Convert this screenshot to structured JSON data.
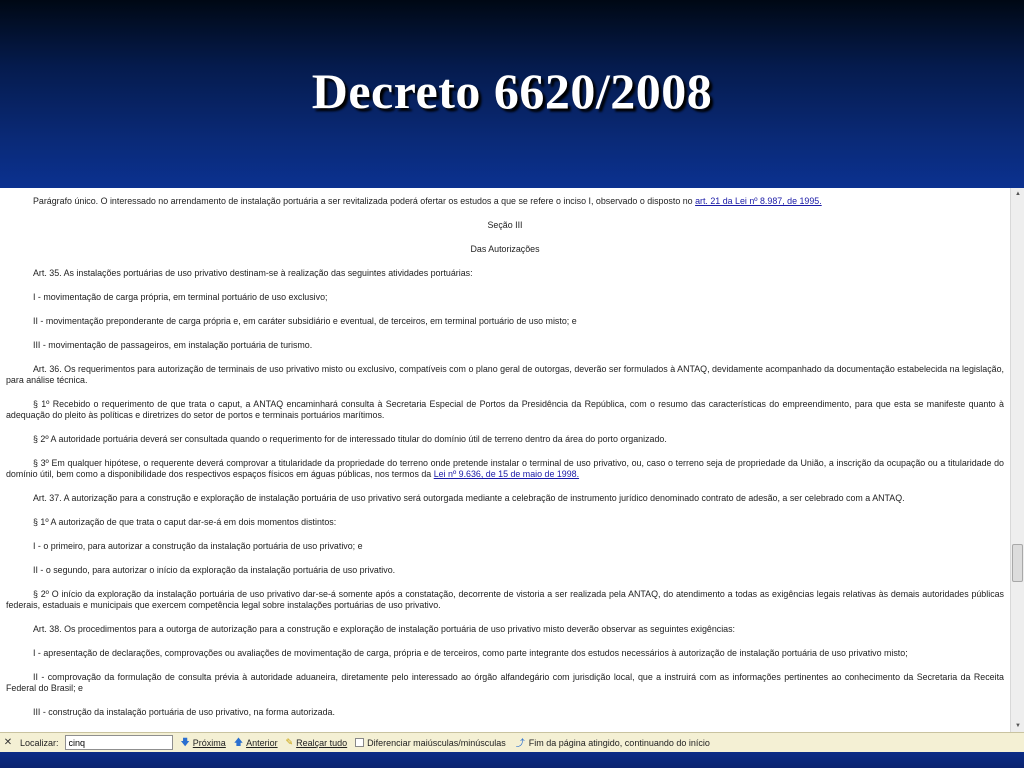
{
  "slide": {
    "title": "Decreto 6620/2008"
  },
  "document": {
    "paragraphs": [
      {
        "text": "Parágrafo único.  O interessado no arrendamento de instalação portuária a ser revitalizada poderá ofertar os estudos a que se refere o inciso I, observado o disposto no ",
        "link": "art. 21 da Lei nº 8.987, de 1995.",
        "after": ""
      },
      {
        "text": "Seção III",
        "center": true
      },
      {
        "text": "Das Autorizações",
        "center": true
      },
      {
        "text": "Art. 35.  As instalações portuárias de uso privativo destinam-se à realização das seguintes atividades portuárias:"
      },
      {
        "text": "I - movimentação de carga própria, em terminal portuário de uso exclusivo;"
      },
      {
        "text": "II - movimentação preponderante de carga própria e, em caráter subsidiário e eventual, de terceiros, em terminal portuário de uso misto; e"
      },
      {
        "text": "III - movimentação de passageiros, em instalação portuária de turismo."
      },
      {
        "text": "Art. 36.  Os requerimentos para autorização de terminais de uso privativo misto ou exclusivo, compatíveis com o plano geral de outorgas, deverão ser formulados à ANTAQ, devidamente acompanhado da documentação estabelecida na legislação, para análise técnica."
      },
      {
        "text": "§ 1º  Recebido o requerimento de que trata o caput, a ANTAQ encaminhará consulta à Secretaria Especial de Portos da Presidência da República, com o resumo das características do empreendimento, para que esta se manifeste quanto à adequação do pleito às políticas e diretrizes do setor de portos e terminais portuários marítimos."
      },
      {
        "text": "§ 2º  A autoridade portuária deverá ser consultada quando o requerimento for de interessado titular do domínio útil de terreno dentro da área do porto organizado."
      },
      {
        "text": "§ 3º  Em qualquer hipótese, o requerente deverá comprovar a titularidade da propriedade do terreno onde pretende instalar o terminal de uso privativo, ou, caso o terreno seja de propriedade da União, a inscrição da ocupação ou a titularidade do domínio útil, bem como a disponibilidade dos respectivos espaços físicos em águas públicas, nos termos da ",
        "link": "Lei nº 9.636, de 15 de maio de 1998.",
        "after": ""
      },
      {
        "text": "Art. 37.  A autorização para a construção e exploração de instalação portuária de uso privativo será outorgada mediante a celebração de instrumento jurídico denominado contrato de adesão, a ser celebrado com a ANTAQ."
      },
      {
        "text": "§ 1º  A autorização de que trata o caput dar-se-á em dois momentos distintos:"
      },
      {
        "text": "I - o primeiro, para autorizar a construção da instalação portuária de uso privativo; e"
      },
      {
        "text": "II - o segundo, para autorizar o início da exploração da instalação portuária de uso privativo."
      },
      {
        "text": "§ 2º  O início da exploração da instalação portuária de uso privativo dar-se-á somente após a constatação, decorrente de vistoria a ser realizada pela ANTAQ, do atendimento a todas as exigências legais relativas às demais autoridades públicas federais, estaduais e municipais que exercem competência legal sobre instalações portuárias de uso privativo."
      },
      {
        "text": "Art. 38.  Os procedimentos para a outorga de autorização para a construção e exploração de instalação portuária de uso privativo misto deverão observar as seguintes exigências:"
      },
      {
        "text": "I - apresentação de declarações, comprovações ou avaliações de movimentação de carga, própria e de terceiros, como parte integrante dos estudos necessários à autorização de instalação portuária de uso privativo misto;"
      },
      {
        "text": "II - comprovação da formulação de consulta prévia à autoridade aduaneira, diretamente pelo interessado ao órgão alfandegário com jurisdição local, que a instruirá com as informações pertinentes ao conhecimento da Secretaria da Receita Federal do Brasil; e"
      },
      {
        "text": "III - construção da instalação portuária de uso privativo, na forma autorizada."
      }
    ]
  },
  "findbar": {
    "close_icon": "close-icon",
    "label": "Localizar:",
    "query": "cinq",
    "next_label": "Próxima",
    "prev_label": "Anterior",
    "highlight_label": "Realçar tudo",
    "matchcase_label": "Diferenciar maiúsculas/minúsculas",
    "status": "Fim da página atingido, continuando do início"
  }
}
